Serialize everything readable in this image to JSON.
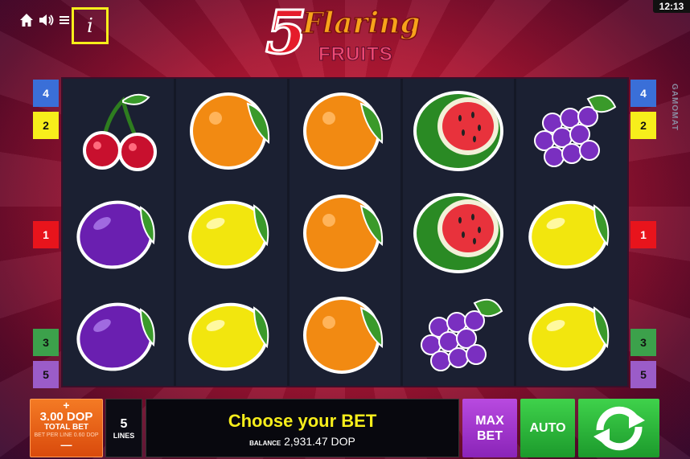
{
  "status_bar": {
    "time": "12:13"
  },
  "toolbar": {
    "info_label": "i"
  },
  "logo": {
    "five": "5",
    "flaring": "Flaring",
    "fruits": "FRUITS"
  },
  "provider": "GAMOMAT",
  "paylines": {
    "left": [
      "4",
      "2",
      "1",
      "3",
      "5"
    ],
    "right": [
      "4",
      "2",
      "1",
      "3",
      "5"
    ]
  },
  "colors": {
    "line1": "#e8141c",
    "line2": "#f7ee1b",
    "line3": "#3ca14b",
    "line4": "#3a6fd8",
    "line5": "#9b5cc8"
  },
  "reels": [
    [
      "cherry",
      "plum",
      "plum"
    ],
    [
      "orange",
      "lemon",
      "lemon"
    ],
    [
      "orange",
      "orange",
      "orange"
    ],
    [
      "watermelon",
      "watermelon",
      "grapes"
    ],
    [
      "grapes",
      "lemon",
      "lemon"
    ]
  ],
  "bet": {
    "plus": "+",
    "value": "3.00 DOP",
    "label": "TOTAL BET",
    "per_line": "BET PER LINE 0.60 DOP",
    "minus": "—"
  },
  "lines": {
    "count": "5",
    "label": "LINES"
  },
  "message": {
    "main": "Choose your BET",
    "balance_label": "BALANCE",
    "balance_value": "2,931.47 DOP"
  },
  "buttons": {
    "max_bet_line1": "MAX",
    "max_bet_line2": "BET",
    "auto": "AUTO"
  }
}
